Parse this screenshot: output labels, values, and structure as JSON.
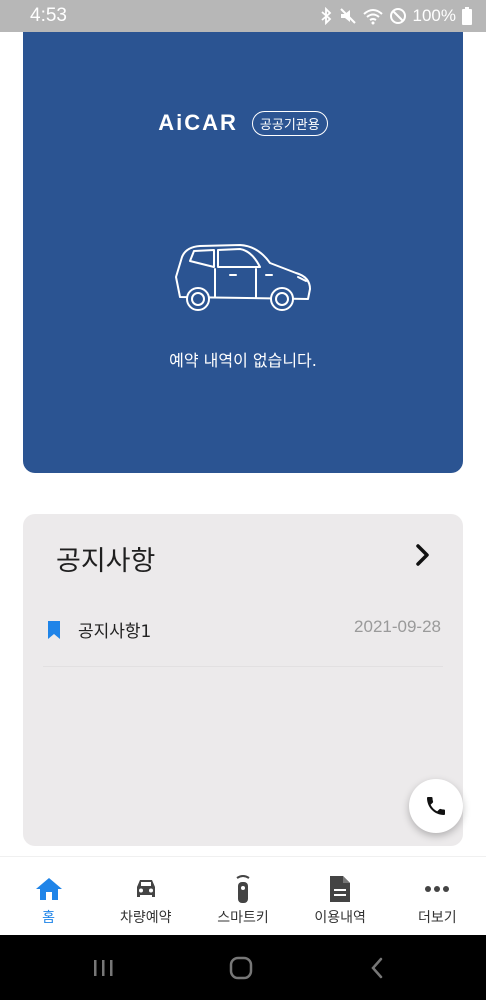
{
  "status_bar": {
    "time": "4:53",
    "battery": "100%",
    "icons": [
      "bluetooth-icon",
      "mute-icon",
      "wifi-icon",
      "dnd-icon",
      "battery-icon"
    ]
  },
  "hero": {
    "logo": "AiCAR",
    "badge": "공공기관용",
    "empty_message": "예약 내역이 없습니다.",
    "background_color": "#2b5492"
  },
  "notice": {
    "title": "공지사항",
    "items": [
      {
        "title": "공지사항1",
        "date": "2021-09-28"
      }
    ]
  },
  "bottom_nav": {
    "items": [
      {
        "label": "홈",
        "icon": "home-icon",
        "active": true
      },
      {
        "label": "차량예약",
        "icon": "car-icon",
        "active": false
      },
      {
        "label": "스마트키",
        "icon": "smart-key-icon",
        "active": false
      },
      {
        "label": "이용내역",
        "icon": "document-icon",
        "active": false
      },
      {
        "label": "더보기",
        "icon": "more-icon",
        "active": false
      }
    ],
    "active_color": "#1f84e8"
  },
  "system_nav": [
    "recent-apps-icon",
    "home-icon",
    "back-icon"
  ]
}
